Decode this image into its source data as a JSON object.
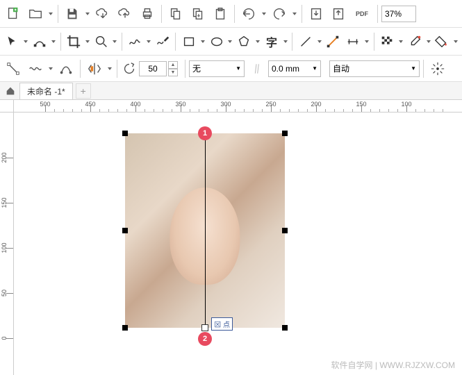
{
  "zoom": "37%",
  "line_style": "无",
  "line_width": "0.0 mm",
  "auto_dropdown": "自动",
  "rotation": "50",
  "tab_name": "未命名 -1*",
  "ruler_h_ticks": [
    "500",
    "450",
    "400",
    "350",
    "300",
    "250",
    "200",
    "150",
    "100"
  ],
  "ruler_v_ticks": [
    "200",
    "150",
    "100",
    "50",
    "0"
  ],
  "marker1": "1",
  "marker2": "2",
  "node_label": "⊠ 点",
  "watermark_left": "软件自学网",
  "watermark_right": "WWW.RJZXW.COM",
  "toolbar1_icons": [
    "new",
    "open",
    "save",
    "cloud-down",
    "cloud-up",
    "print",
    "copy",
    "paste",
    "clipboard",
    "undo",
    "redo",
    "import",
    "export",
    "pdf"
  ],
  "toolbar2_icons": [
    "pick",
    "shape-edit",
    "crop",
    "zoom",
    "freehand",
    "pen",
    "rectangle",
    "ellipse",
    "polygon",
    "star",
    "text",
    "crop-tool",
    "knife",
    "connector",
    "eyedropper",
    "checker",
    "color-eyedropper",
    "fill"
  ],
  "toolbar3_icons": [
    "line-node",
    "wave",
    "curve",
    "mirror",
    "rotate"
  ],
  "snap_icon": "snap"
}
